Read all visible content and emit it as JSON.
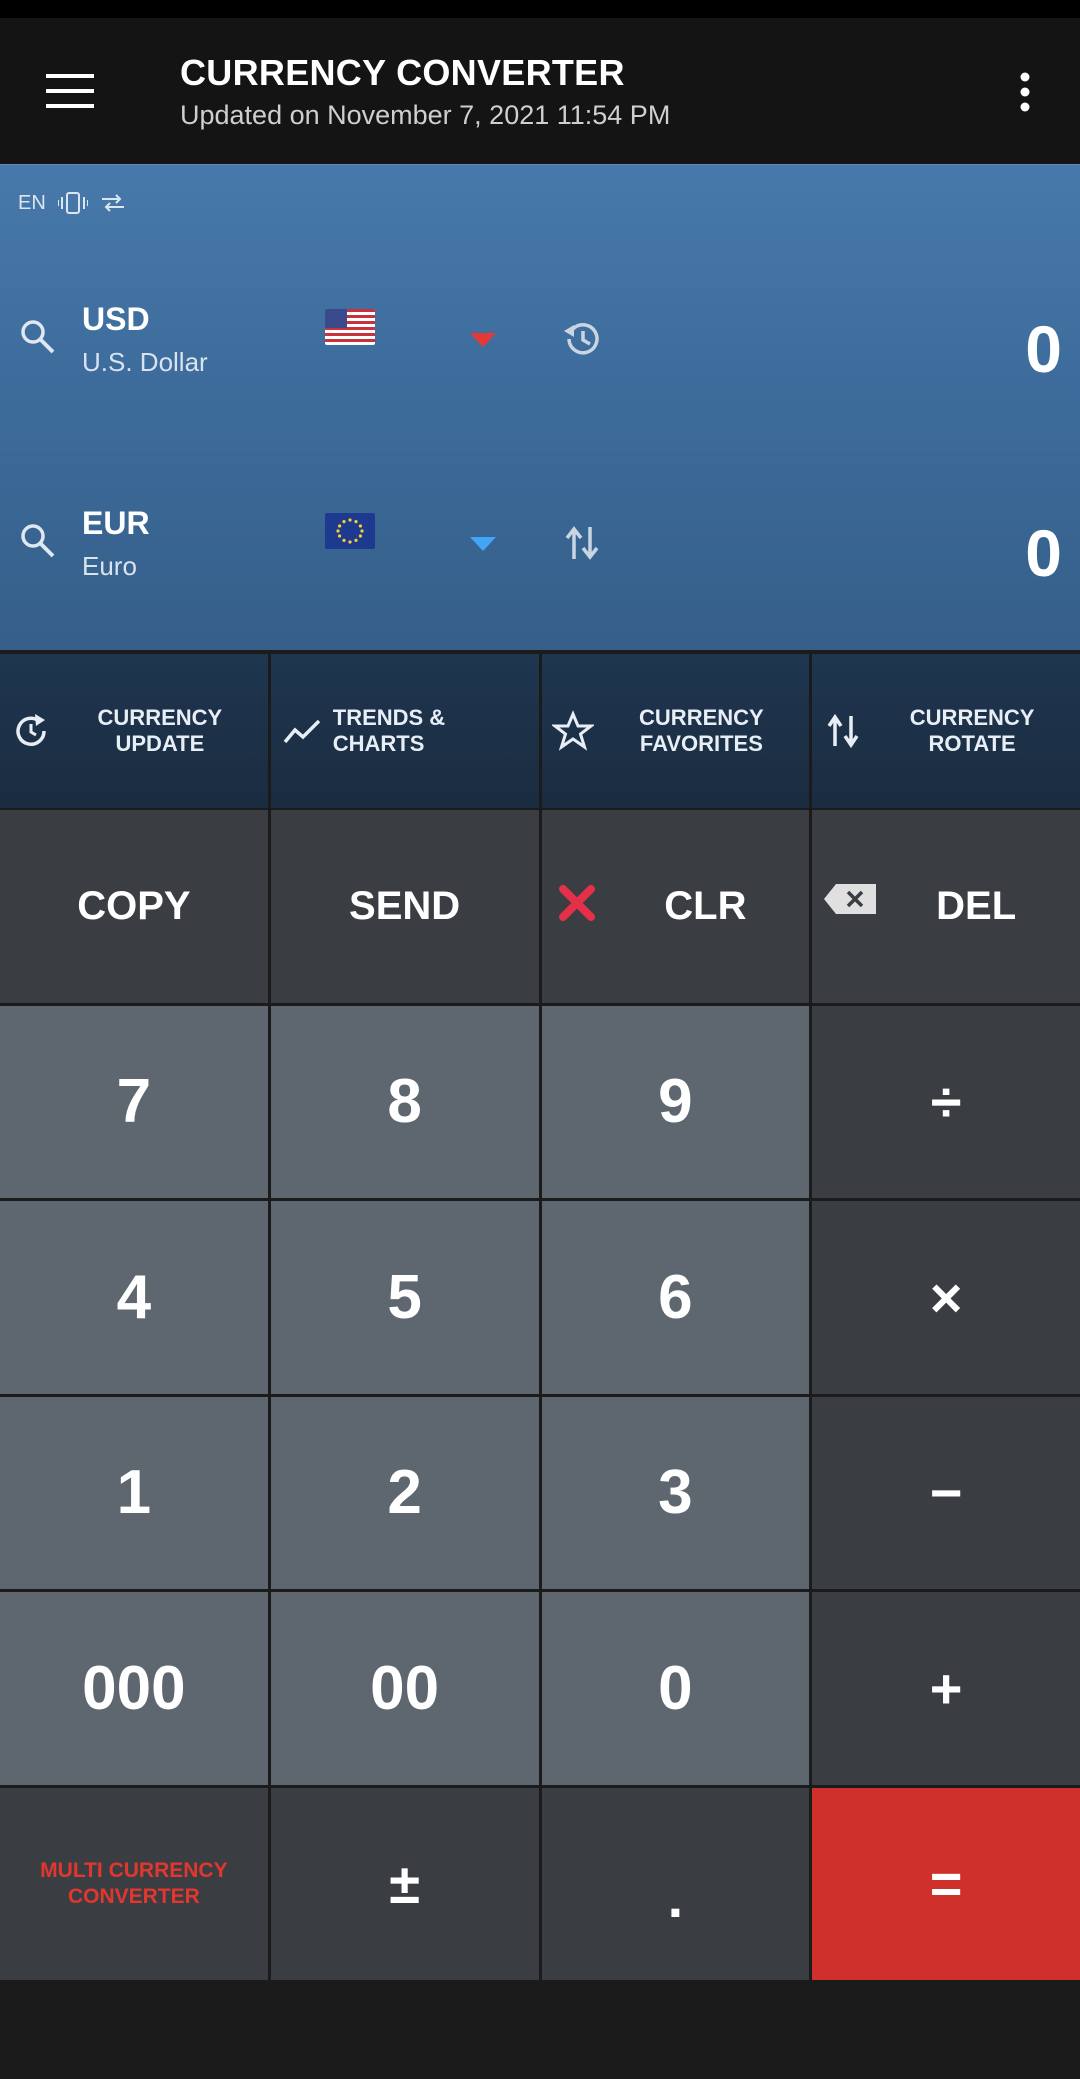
{
  "app": {
    "title": "CURRENCY CONVERTER",
    "updated": "Updated on November 7, 2021 11:54 PM"
  },
  "mini_bar": {
    "lang": "EN"
  },
  "from": {
    "code": "USD",
    "name": "U.S. Dollar",
    "amount": "0",
    "flag": "us-flag",
    "caret_color": "#e53935"
  },
  "to": {
    "code": "EUR",
    "name": "Euro",
    "amount": "0",
    "flag": "eu-flag",
    "caret_color": "#42a5f5"
  },
  "tools": [
    {
      "label": "CURRENCY\nUPDATE",
      "icon": "refresh-icon"
    },
    {
      "label": "TRENDS & CHARTS",
      "icon": "trend-icon"
    },
    {
      "label": "CURRENCY\nFAVORITES",
      "icon": "star-icon"
    },
    {
      "label": "CURRENCY\nROTATE",
      "icon": "swap-icon"
    }
  ],
  "keys": {
    "copy": "COPY",
    "send": "SEND",
    "clr": "CLR",
    "del": "DEL",
    "k7": "7",
    "k8": "8",
    "k9": "9",
    "div": "÷",
    "k4": "4",
    "k5": "5",
    "k6": "6",
    "mul": "×",
    "k1": "1",
    "k2": "2",
    "k3": "3",
    "sub": "−",
    "k000": "000",
    "k00": "00",
    "k0": "0",
    "add": "+",
    "multi": "MULTI CURRENCY\nCONVERTER",
    "plusminus": "±",
    "dot": ".",
    "eq": "="
  },
  "colors": {
    "accent_red": "#d0302b",
    "converter_blue": "#4779aa"
  }
}
